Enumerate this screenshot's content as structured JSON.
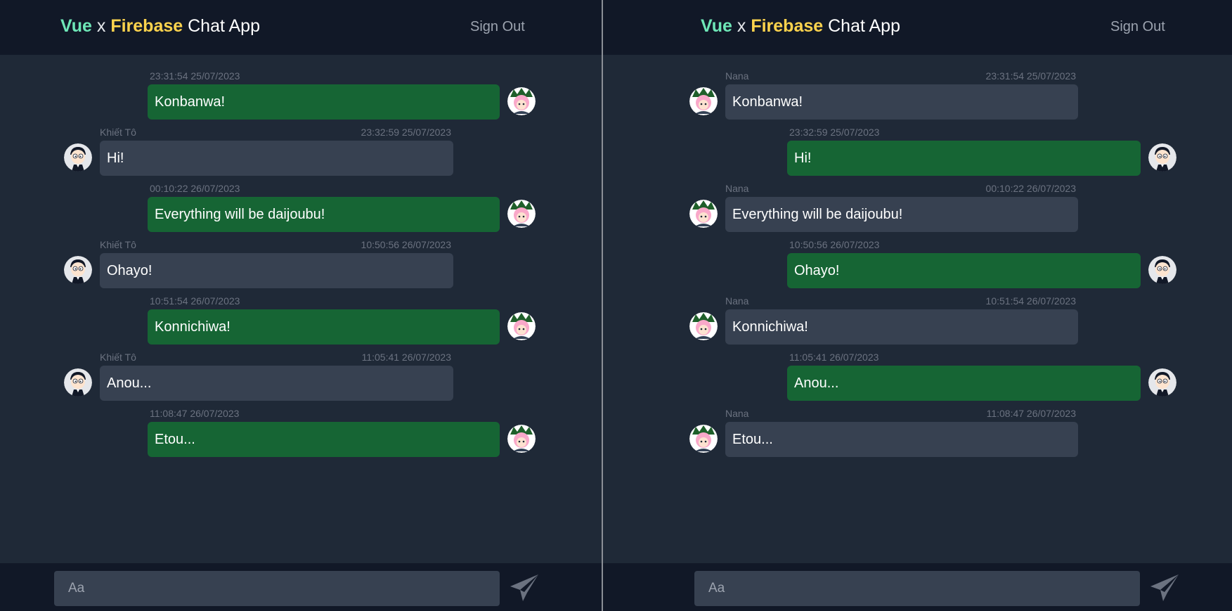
{
  "colors": {
    "brand_vue": "#6ee7b7",
    "brand_firebase": "#fcd34d",
    "mine_bubble": "#166534",
    "theirs_bubble": "#374151",
    "header_bg": "#111827",
    "body_bg": "#1f2937"
  },
  "icons": {
    "send": "paper-plane-icon",
    "avatar_nana": "anime-girl-avatar",
    "avatar_khiet": "cartoon-boy-avatar"
  },
  "left": {
    "header": {
      "brand_vue": "Vue",
      "brand_x": "x",
      "brand_firebase": "Firebase",
      "brand_rest": "Chat App",
      "signout_label": "Sign Out"
    },
    "composer": {
      "placeholder": "Aa"
    },
    "messages": [
      {
        "mine": true,
        "sender": "",
        "time": "23:31:54 25/07/2023",
        "text": "Konbanwa!"
      },
      {
        "mine": false,
        "sender": "Khiết Tô",
        "time": "23:32:59 25/07/2023",
        "text": "Hi!"
      },
      {
        "mine": true,
        "sender": "",
        "time": "00:10:22 26/07/2023",
        "text": "Everything will be daijoubu!"
      },
      {
        "mine": false,
        "sender": "Khiết Tô",
        "time": "10:50:56 26/07/2023",
        "text": "Ohayo!"
      },
      {
        "mine": true,
        "sender": "",
        "time": "10:51:54 26/07/2023",
        "text": "Konnichiwa!"
      },
      {
        "mine": false,
        "sender": "Khiết Tô",
        "time": "11:05:41 26/07/2023",
        "text": "Anou..."
      },
      {
        "mine": true,
        "sender": "",
        "time": "11:08:47 26/07/2023",
        "text": "Etou..."
      }
    ]
  },
  "right": {
    "header": {
      "brand_vue": "Vue",
      "brand_x": "x",
      "brand_firebase": "Firebase",
      "brand_rest": "Chat App",
      "signout_label": "Sign Out"
    },
    "composer": {
      "placeholder": "Aa"
    },
    "messages": [
      {
        "mine": false,
        "sender": "Nana",
        "time": "23:31:54 25/07/2023",
        "text": "Konbanwa!"
      },
      {
        "mine": true,
        "sender": "",
        "time": "23:32:59 25/07/2023",
        "text": "Hi!"
      },
      {
        "mine": false,
        "sender": "Nana",
        "time": "00:10:22 26/07/2023",
        "text": "Everything will be daijoubu!"
      },
      {
        "mine": true,
        "sender": "",
        "time": "10:50:56 26/07/2023",
        "text": "Ohayo!"
      },
      {
        "mine": false,
        "sender": "Nana",
        "time": "10:51:54 26/07/2023",
        "text": "Konnichiwa!"
      },
      {
        "mine": true,
        "sender": "",
        "time": "11:05:41 26/07/2023",
        "text": "Anou..."
      },
      {
        "mine": false,
        "sender": "Nana",
        "time": "11:08:47 26/07/2023",
        "text": "Etou..."
      }
    ]
  }
}
